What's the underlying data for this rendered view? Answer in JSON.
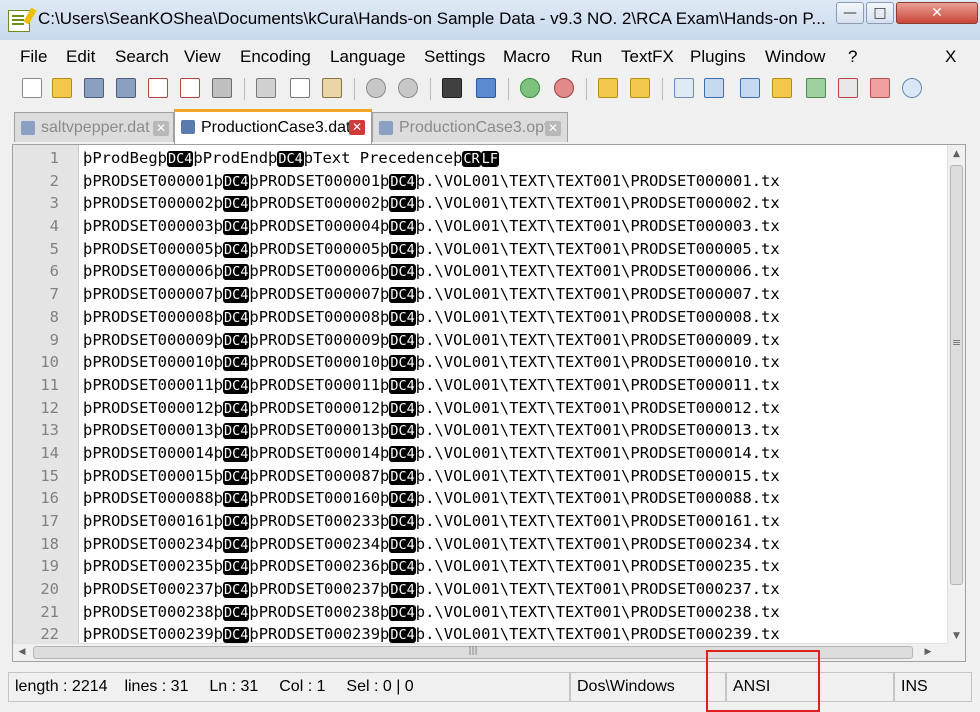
{
  "window": {
    "title": "C:\\Users\\SeanKOShea\\Documents\\kCura\\Hands-on Sample Data - v9.3  NO. 2\\RCA Exam\\Hands-on P...",
    "controls": {
      "minimize": "—",
      "maximize": "□",
      "close": "✕"
    }
  },
  "menu": [
    "File",
    "Edit",
    "Search",
    "View",
    "Encoding",
    "Language",
    "Settings",
    "Macro",
    "Run",
    "TextFX",
    "Plugins",
    "Window",
    "?"
  ],
  "menu_close": "X",
  "toolbar": [
    "new-file-icon",
    "open-file-icon",
    "save-icon",
    "save-all-icon",
    "close-icon",
    "close-all-icon",
    "print-icon",
    "cut-icon",
    "copy-icon",
    "paste-icon",
    "undo-icon",
    "redo-icon",
    "find-icon",
    "replace-icon",
    "zoom-in-icon",
    "zoom-out-icon",
    "sync-vertical-icon",
    "sync-horizontal-icon",
    "word-wrap-icon",
    "show-all-characters-icon",
    "indent-guide-icon",
    "user-defined-dialogue-icon",
    "document-map-icon",
    "function-list-icon",
    "folder-workspace-icon",
    "monitoring-icon"
  ],
  "tabs": [
    {
      "label": "saltvpepper.dat",
      "active": false
    },
    {
      "label": "ProductionCase3.dat",
      "active": true
    },
    {
      "label": "ProductionCase3.opt",
      "active": false
    }
  ],
  "editor": {
    "lines": [
      {
        "n": "1",
        "a": "þProdBegþ",
        "b": "þProdEndþ",
        "c": "þText Precedenceþ",
        "end": "crlf"
      },
      {
        "n": "2",
        "a": "þPRODSET000001þ",
        "b": "þPRODSET000001þ",
        "c": "þ.\\VOL001\\TEXT\\TEXT001\\PRODSET000001.tx"
      },
      {
        "n": "3",
        "a": "þPRODSET000002þ",
        "b": "þPRODSET000002þ",
        "c": "þ.\\VOL001\\TEXT\\TEXT001\\PRODSET000002.tx"
      },
      {
        "n": "4",
        "a": "þPRODSET000003þ",
        "b": "þPRODSET000004þ",
        "c": "þ.\\VOL001\\TEXT\\TEXT001\\PRODSET000003.tx"
      },
      {
        "n": "5",
        "a": "þPRODSET000005þ",
        "b": "þPRODSET000005þ",
        "c": "þ.\\VOL001\\TEXT\\TEXT001\\PRODSET000005.tx"
      },
      {
        "n": "6",
        "a": "þPRODSET000006þ",
        "b": "þPRODSET000006þ",
        "c": "þ.\\VOL001\\TEXT\\TEXT001\\PRODSET000006.tx"
      },
      {
        "n": "7",
        "a": "þPRODSET000007þ",
        "b": "þPRODSET000007þ",
        "c": "þ.\\VOL001\\TEXT\\TEXT001\\PRODSET000007.tx"
      },
      {
        "n": "8",
        "a": "þPRODSET000008þ",
        "b": "þPRODSET000008þ",
        "c": "þ.\\VOL001\\TEXT\\TEXT001\\PRODSET000008.tx"
      },
      {
        "n": "9",
        "a": "þPRODSET000009þ",
        "b": "þPRODSET000009þ",
        "c": "þ.\\VOL001\\TEXT\\TEXT001\\PRODSET000009.tx"
      },
      {
        "n": "10",
        "a": "þPRODSET000010þ",
        "b": "þPRODSET000010þ",
        "c": "þ.\\VOL001\\TEXT\\TEXT001\\PRODSET000010.tx"
      },
      {
        "n": "11",
        "a": "þPRODSET000011þ",
        "b": "þPRODSET000011þ",
        "c": "þ.\\VOL001\\TEXT\\TEXT001\\PRODSET000011.tx"
      },
      {
        "n": "12",
        "a": "þPRODSET000012þ",
        "b": "þPRODSET000012þ",
        "c": "þ.\\VOL001\\TEXT\\TEXT001\\PRODSET000012.tx"
      },
      {
        "n": "13",
        "a": "þPRODSET000013þ",
        "b": "þPRODSET000013þ",
        "c": "þ.\\VOL001\\TEXT\\TEXT001\\PRODSET000013.tx"
      },
      {
        "n": "14",
        "a": "þPRODSET000014þ",
        "b": "þPRODSET000014þ",
        "c": "þ.\\VOL001\\TEXT\\TEXT001\\PRODSET000014.tx"
      },
      {
        "n": "15",
        "a": "þPRODSET000015þ",
        "b": "þPRODSET000087þ",
        "c": "þ.\\VOL001\\TEXT\\TEXT001\\PRODSET000015.tx"
      },
      {
        "n": "16",
        "a": "þPRODSET000088þ",
        "b": "þPRODSET000160þ",
        "c": "þ.\\VOL001\\TEXT\\TEXT001\\PRODSET000088.tx"
      },
      {
        "n": "17",
        "a": "þPRODSET000161þ",
        "b": "þPRODSET000233þ",
        "c": "þ.\\VOL001\\TEXT\\TEXT001\\PRODSET000161.tx"
      },
      {
        "n": "18",
        "a": "þPRODSET000234þ",
        "b": "þPRODSET000234þ",
        "c": "þ.\\VOL001\\TEXT\\TEXT001\\PRODSET000234.tx"
      },
      {
        "n": "19",
        "a": "þPRODSET000235þ",
        "b": "þPRODSET000236þ",
        "c": "þ.\\VOL001\\TEXT\\TEXT001\\PRODSET000235.tx"
      },
      {
        "n": "20",
        "a": "þPRODSET000237þ",
        "b": "þPRODSET000237þ",
        "c": "þ.\\VOL001\\TEXT\\TEXT001\\PRODSET000237.tx"
      },
      {
        "n": "21",
        "a": "þPRODSET000238þ",
        "b": "þPRODSET000238þ",
        "c": "þ.\\VOL001\\TEXT\\TEXT001\\PRODSET000238.tx"
      },
      {
        "n": "22",
        "a": "þPRODSET000239þ",
        "b": "þPRODSET000239þ",
        "c": "þ.\\VOL001\\TEXT\\TEXT001\\PRODSET000239.tx"
      }
    ],
    "control_chars": {
      "dc4": "DC4",
      "cr": "CR",
      "lf": "LF"
    },
    "scroll_glyphs": {
      "up": "▲",
      "down": "▼",
      "left": "◀",
      "right": "▶",
      "grip_v": "≡",
      "grip_h": "|||"
    }
  },
  "status": {
    "length": "length : 2214",
    "lines": "lines : 31",
    "ln": "Ln : 31",
    "col": "Col : 1",
    "sel": "Sel : 0 | 0",
    "eol": "Dos\\Windows",
    "encoding": "ANSI",
    "mode": "INS"
  },
  "colors": {
    "highlight": "#e0201e",
    "active_tab_accent": "#f5a623",
    "close_red": "#c8463a"
  }
}
